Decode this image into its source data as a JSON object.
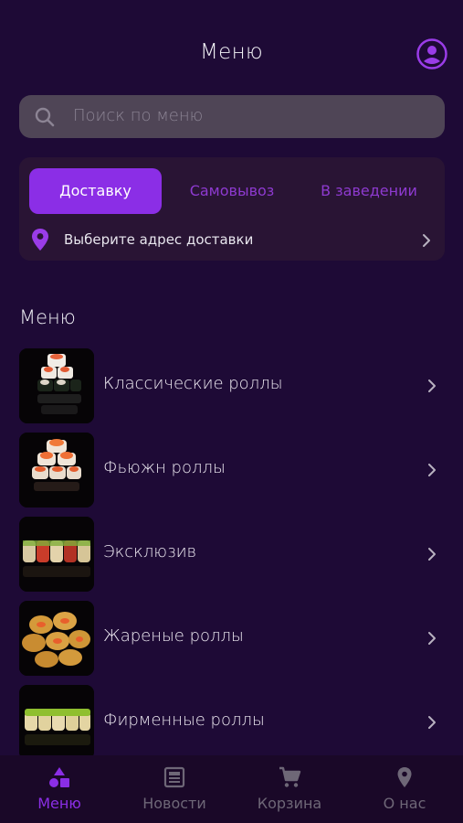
{
  "header": {
    "title": "Меню"
  },
  "search": {
    "placeholder": "Поиск по меню"
  },
  "order_modes": {
    "tabs": [
      {
        "label": "Доставку",
        "active": true
      },
      {
        "label": "Самовывоз",
        "active": false
      },
      {
        "label": "В заведении",
        "active": false
      }
    ],
    "address_prompt": "Выберите адрес доставки"
  },
  "menu": {
    "title": "Меню",
    "items": [
      {
        "label": "Классические роллы"
      },
      {
        "label": "Фьюжн роллы"
      },
      {
        "label": "Эксклюзив"
      },
      {
        "label": "Жареные роллы"
      },
      {
        "label": "Фирменные роллы"
      }
    ]
  },
  "bottom_nav": {
    "items": [
      {
        "label": "Меню",
        "icon": "category-shapes-icon",
        "active": true
      },
      {
        "label": "Новости",
        "icon": "news-icon",
        "active": false
      },
      {
        "label": "Корзина",
        "icon": "cart-icon",
        "active": false
      },
      {
        "label": "О нас",
        "icon": "location-pin-icon",
        "active": false
      }
    ]
  },
  "colors": {
    "background": "#1e0a36",
    "accent": "#8b2ee6",
    "card": "#291434",
    "search_field": "#4f4556",
    "inactive_nav": "#6e6777"
  }
}
